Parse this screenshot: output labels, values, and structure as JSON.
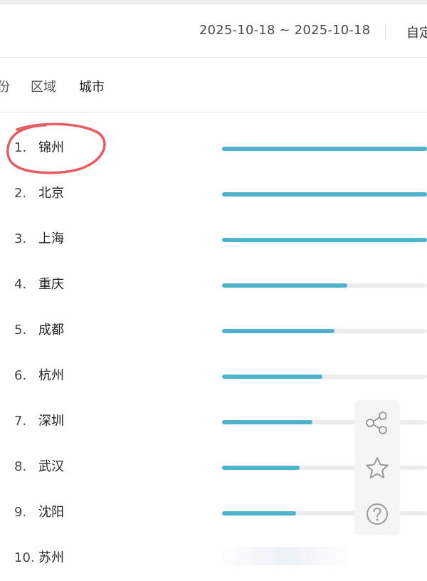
{
  "header": {
    "date_range": "2025-10-18 ~ 2025-10-18",
    "custom_label": "自定"
  },
  "tabs": [
    {
      "label": "份",
      "active": false
    },
    {
      "label": "区域",
      "active": false
    },
    {
      "label": "城市",
      "active": true
    }
  ],
  "ranking": [
    {
      "rank": "1.",
      "city": "锦州",
      "level": 1.0
    },
    {
      "rank": "2.",
      "city": "北京",
      "level": 1.0
    },
    {
      "rank": "3.",
      "city": "上海",
      "level": 1.0
    },
    {
      "rank": "4.",
      "city": "重庆",
      "level": 0.61
    },
    {
      "rank": "5.",
      "city": "成都",
      "level": 0.55
    },
    {
      "rank": "6.",
      "city": "杭州",
      "level": 0.49
    },
    {
      "rank": "7.",
      "city": "深圳",
      "level": 0.44
    },
    {
      "rank": "8.",
      "city": "武汉",
      "level": 0.38
    },
    {
      "rank": "9.",
      "city": "沈阳",
      "level": 0.36
    },
    {
      "rank": "10.",
      "city": "苏州",
      "level": 0.0
    }
  ],
  "floating_tools": [
    {
      "icon": "share-icon"
    },
    {
      "icon": "star-icon"
    },
    {
      "icon": "help-icon"
    }
  ],
  "colors": {
    "bar": "#4fb4cb",
    "track": "#ececec",
    "highlight_circle": "#e2424a"
  }
}
